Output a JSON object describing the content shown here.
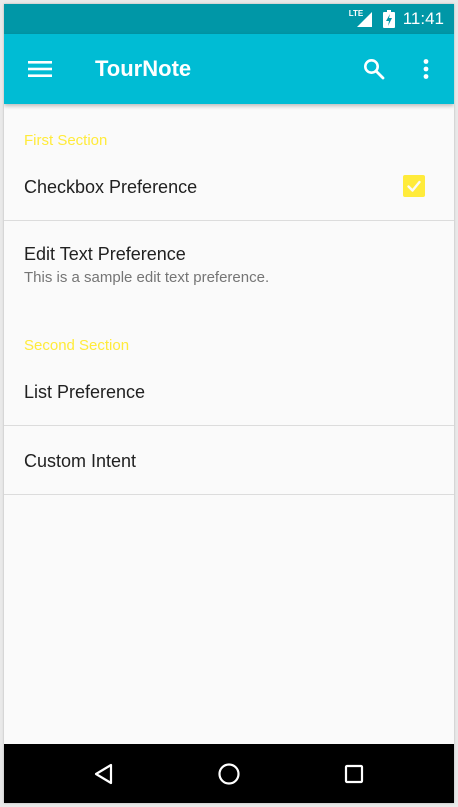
{
  "status_bar": {
    "network_label": "LTE",
    "time": "11:41"
  },
  "app_bar": {
    "title": "TourNote",
    "icons": [
      "menu-icon",
      "search-icon",
      "more-vert-icon"
    ]
  },
  "sections": [
    {
      "header": "First Section"
    },
    {
      "header": "Second Section"
    }
  ],
  "preferences": {
    "checkbox": {
      "title": "Checkbox Preference",
      "checked": true
    },
    "edit_text": {
      "title": "Edit Text Preference",
      "summary": "This is a sample edit text preference."
    },
    "list": {
      "title": "List Preference"
    },
    "custom_intent": {
      "title": "Custom Intent"
    }
  },
  "nav_bar": {
    "icons": [
      "back-icon",
      "home-icon",
      "recents-icon"
    ]
  },
  "colors": {
    "status_bar": "#0097a7",
    "app_bar": "#00bcd4",
    "accent": "#ffeb3b",
    "background": "#fafafa",
    "primary_text": "#212121",
    "secondary_text": "#757575"
  }
}
